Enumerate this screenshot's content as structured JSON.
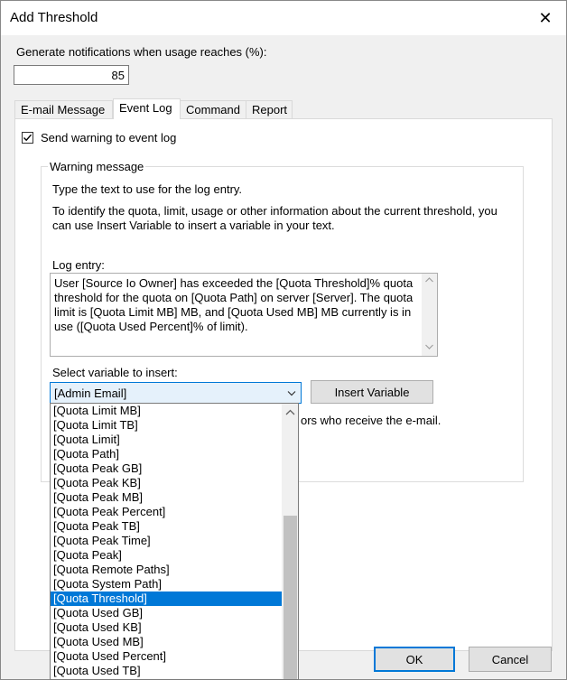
{
  "window": {
    "title": "Add Threshold",
    "close_glyph": "✕"
  },
  "notify": {
    "label": "Generate notifications when usage reaches (%):",
    "value": "85"
  },
  "tabs": [
    {
      "label": "E-mail Message",
      "active": false
    },
    {
      "label": "Event Log",
      "active": true
    },
    {
      "label": "Command",
      "active": false
    },
    {
      "label": "Report",
      "active": false
    }
  ],
  "event_log": {
    "send_warning_label": "Send warning to event log",
    "send_warning_checked": true,
    "warning_group_title": "Warning message",
    "instruction_1": "Type the text to use for the log entry.",
    "instruction_2": "To identify the quota, limit, usage or other information about the current threshold, you can use Insert Variable to insert a variable in your text.",
    "log_entry_label": "Log entry:",
    "log_entry_text": "User [Source Io Owner] has exceeded the [Quota Threshold]% quota threshold for the quota on [Quota Path] on server [Server]. The quota limit is [Quota Limit MB] MB, and [Quota Used MB] MB currently is in use ([Quota Used Percent]% of limit).",
    "select_variable_label": "Select variable to insert:",
    "selected_variable": "[Admin Email]",
    "insert_variable_button": "Insert Variable",
    "variable_hint_partial": "ors who receive the e-mail."
  },
  "dropdown": {
    "items": [
      "[Quota Limit MB]",
      "[Quota Limit TB]",
      "[Quota Limit]",
      "[Quota Path]",
      "[Quota Peak GB]",
      "[Quota Peak KB]",
      "[Quota Peak MB]",
      "[Quota Peak Percent]",
      "[Quota Peak TB]",
      "[Quota Peak Time]",
      "[Quota Peak]",
      "[Quota Remote Paths]",
      "[Quota System Path]",
      "[Quota Threshold]",
      "[Quota Used GB]",
      "[Quota Used KB]",
      "[Quota Used MB]",
      "[Quota Used Percent]",
      "[Quota Used TB]"
    ],
    "highlighted": "[Quota Threshold]"
  },
  "footer": {
    "ok_label": "OK",
    "cancel_label": "Cancel"
  },
  "colors": {
    "accent": "#0078d7",
    "panel_bg": "#ffffff",
    "dialog_bg": "#f0f0f0"
  }
}
